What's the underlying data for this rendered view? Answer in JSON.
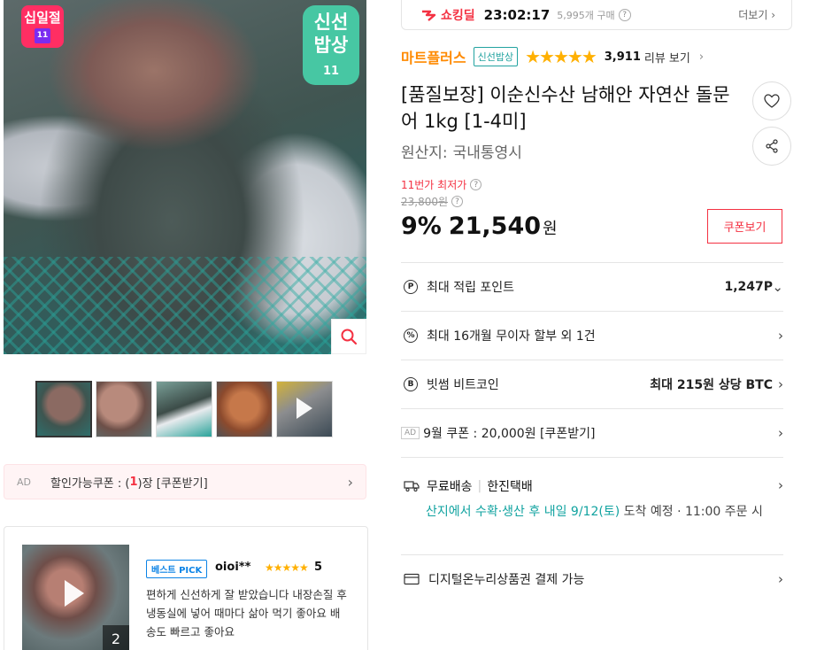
{
  "gallery": {
    "badge_sipil": "십일절",
    "badge_fresh_line1": "신선",
    "badge_fresh_line2": "밥상",
    "badge_fresh_logo": "11",
    "thumb_count": 5
  },
  "coupon_bar": {
    "ad": "AD",
    "prefix": "할인가능쿠폰 : (",
    "count": "1",
    "suffix": ")장 [쿠폰받기]"
  },
  "review": {
    "badge": "베스트 PICK",
    "reviewer": "oioi**",
    "stars": "★★★★★",
    "score": "5",
    "photo_count": "2",
    "text": "편하게 신선하게 잘 받았습니다 내장손질 후 냉동실에 넣어 때마다 삶아 먹기 좋아요 배송도 빠르고 좋아요"
  },
  "shocking_deal": {
    "logo": "쇼킹딜",
    "time": "23:02:17",
    "sold": "5,995개 구매",
    "more": "더보기"
  },
  "product": {
    "seller": "마트플러스",
    "fresh_tag": "신선밥상",
    "rating_stars": "★★★★★",
    "review_count": "3,911",
    "review_link": "리뷰 보기",
    "title": "[품질보장] 이순신수산 남해안 자연산 돌문어 1kg [1-4미]",
    "origin_label": "원산지:",
    "origin_value": "국내통영시"
  },
  "price": {
    "lowest_label": "11번가 최저가",
    "original": "23,800원",
    "discount": "9%",
    "amount": "21,540",
    "unit": "원",
    "coupon_button": "쿠폰보기"
  },
  "info": {
    "points_label": "최대 적립 포인트",
    "points_value": "1,247P",
    "installment": "최대 16개월 무이자 할부 외 1건",
    "bitcoin_label": "빗썸 비트코인",
    "bitcoin_value": "최대 215원 상당 BTC",
    "ad": "AD",
    "coupon_event": "9월 쿠폰 : 20,000원 [쿠폰받기]",
    "shipping_free": "무료배송",
    "shipping_carrier": "한진택배",
    "shipping_delivery": "산지에서 수확·생산 후 내일 9/12(토)",
    "shipping_arrive": "도착 예정",
    "shipping_cutoff": "11:00 주문 시",
    "voucher": "디지털온누리상품권 결제 가능"
  }
}
